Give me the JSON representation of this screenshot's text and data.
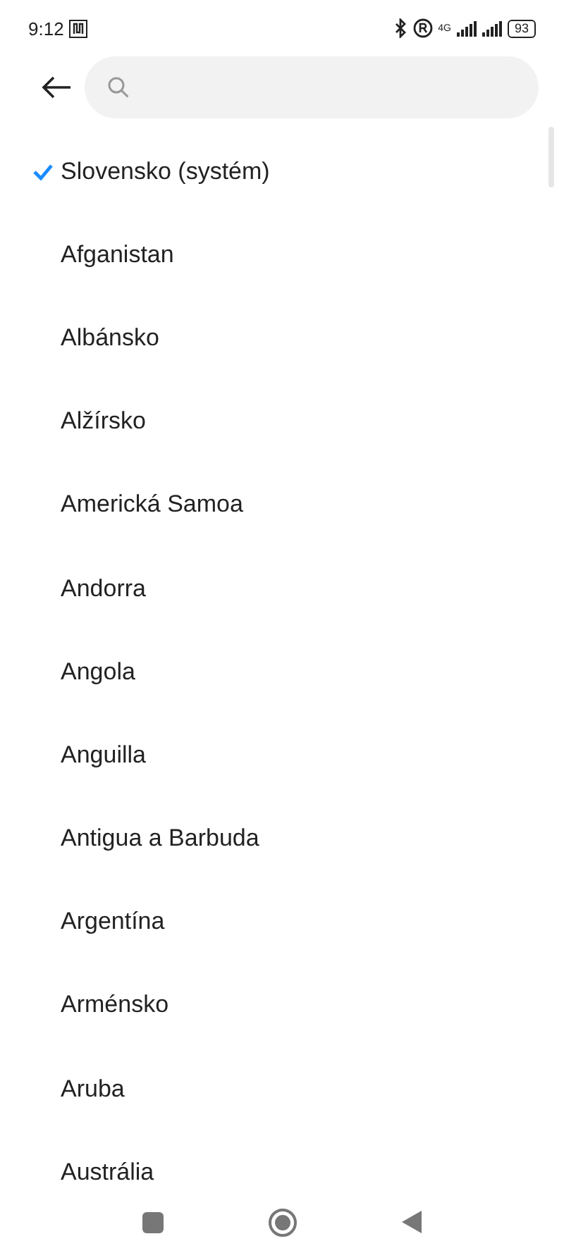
{
  "status_bar": {
    "time": "9:12",
    "network": "4G",
    "battery": "93"
  },
  "countries": [
    {
      "name": "Slovensko (systém)",
      "selected": true
    },
    {
      "name": "Afganistan",
      "selected": false
    },
    {
      "name": "Albánsko",
      "selected": false
    },
    {
      "name": "Alžírsko",
      "selected": false
    },
    {
      "name": "Americká Samoa",
      "selected": false
    },
    {
      "name": "Andorra",
      "selected": false
    },
    {
      "name": "Angola",
      "selected": false
    },
    {
      "name": "Anguilla",
      "selected": false
    },
    {
      "name": "Antigua a Barbuda",
      "selected": false
    },
    {
      "name": "Argentína",
      "selected": false
    },
    {
      "name": "Arménsko",
      "selected": false
    },
    {
      "name": "Aruba",
      "selected": false
    },
    {
      "name": "Austrália",
      "selected": false
    }
  ]
}
